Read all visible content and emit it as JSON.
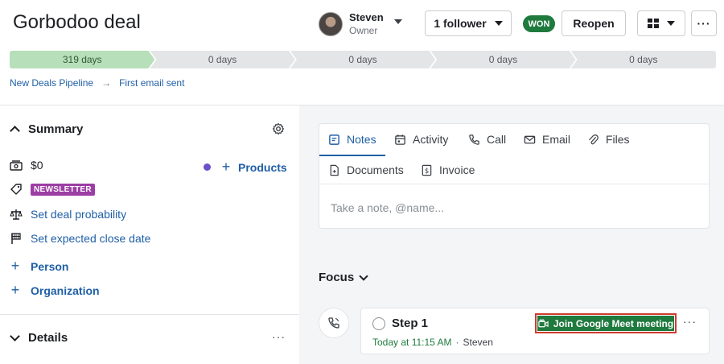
{
  "header": {
    "title": "Gorbodoo deal",
    "owner": {
      "name": "Steven",
      "role": "Owner"
    },
    "follower_label": "1 follower",
    "status_badge": "WON",
    "reopen_label": "Reopen",
    "more_label": "···"
  },
  "pipeline": {
    "stages": [
      "319 days",
      "0 days",
      "0 days",
      "0 days",
      "0 days"
    ],
    "completed_stages": 1
  },
  "breadcrumb": {
    "pipeline": "New Deals Pipeline",
    "stage": "First email sent"
  },
  "summary": {
    "title": "Summary",
    "value": "$0",
    "products_label": "Products",
    "tag": "NEWSLETTER",
    "probability_link": "Set deal probability",
    "close_date_link": "Set expected close date",
    "person_label": "Person",
    "organization_label": "Organization"
  },
  "details": {
    "title": "Details",
    "more_label": "···"
  },
  "notes_card": {
    "tabs": [
      {
        "label": "Notes",
        "icon": "notes-icon"
      },
      {
        "label": "Activity",
        "icon": "calendar-icon"
      },
      {
        "label": "Call",
        "icon": "phone-icon"
      },
      {
        "label": "Email",
        "icon": "email-icon"
      },
      {
        "label": "Files",
        "icon": "paperclip-icon"
      },
      {
        "label": "Documents",
        "icon": "document-icon"
      },
      {
        "label": "Invoice",
        "icon": "invoice-icon"
      }
    ],
    "active_tab": "Notes",
    "placeholder": "Take a note, @name..."
  },
  "focus": {
    "title": "Focus",
    "step": {
      "title": "Step 1",
      "time": "Today at 11:15 AM",
      "separator": "·",
      "assignee": "Steven",
      "meet_button": "Join Google Meet meeting",
      "more_label": "···"
    }
  },
  "colors": {
    "accent": "#1f5fa6",
    "won": "#1f7a3e",
    "stage_done": "#b7dfb9",
    "tag": "#9c3ea3",
    "highlight_border": "#d23a2c"
  }
}
